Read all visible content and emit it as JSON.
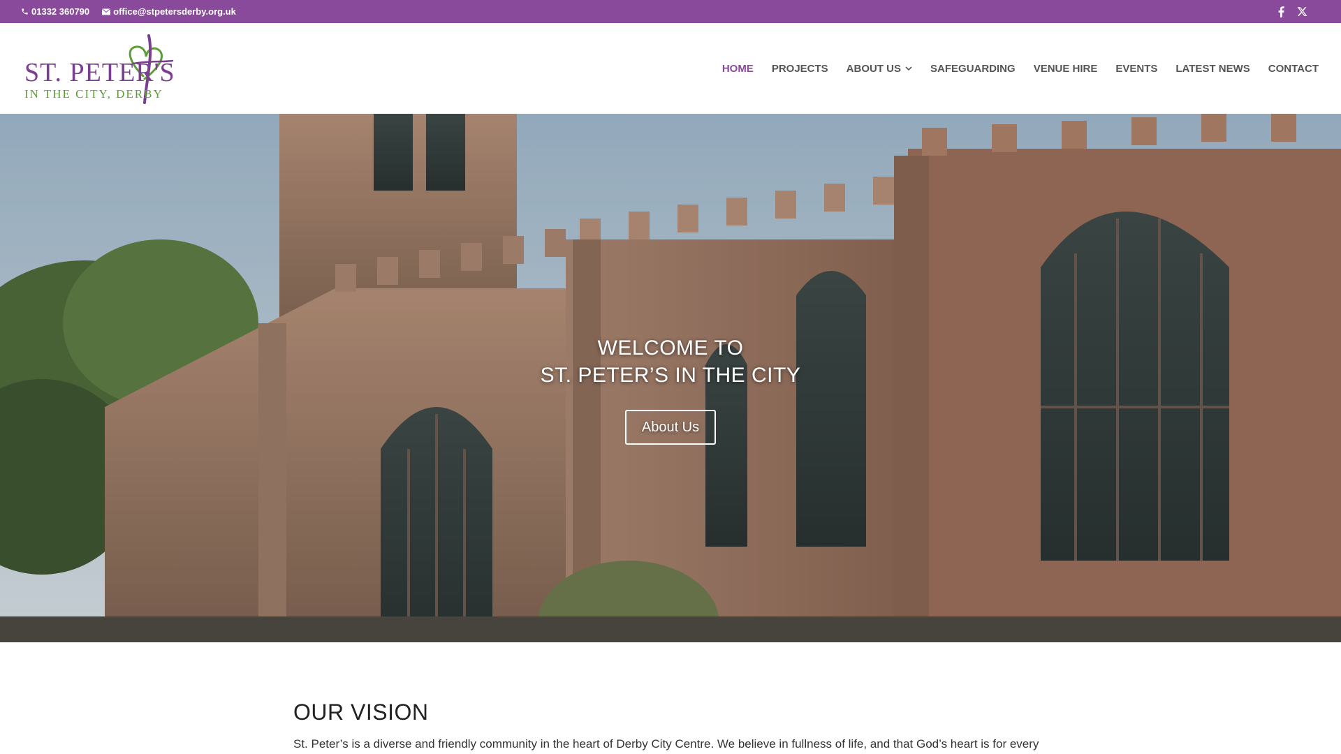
{
  "topbar": {
    "phone": "01332 360790",
    "email": "office@stpetersderby.org.uk",
    "social": [
      "facebook-icon",
      "x-icon"
    ],
    "bg_color": "#8a4a9c"
  },
  "header": {
    "logo": {
      "line1": "ST. PETER'S",
      "line2": "IN THE CITY, DERBY"
    },
    "nav": [
      {
        "label": "HOME",
        "active": true
      },
      {
        "label": "PROJECTS"
      },
      {
        "label": "ABOUT US",
        "has_dropdown": true
      },
      {
        "label": "SAFEGUARDING"
      },
      {
        "label": "VENUE HIRE"
      },
      {
        "label": "EVENTS"
      },
      {
        "label": "LATEST NEWS"
      },
      {
        "label": "CONTACT"
      }
    ],
    "accent_color": "#8a4a9c"
  },
  "hero": {
    "title_line1": "WELCOME TO",
    "title_line2": "ST. PETER’S IN THE CITY",
    "button_label": "About Us"
  },
  "vision": {
    "heading": "OUR VISION",
    "body": "St. Peter’s is a diverse and friendly community in the heart of Derby City Centre. We believe in fullness of life, and that God’s heart is for every"
  }
}
